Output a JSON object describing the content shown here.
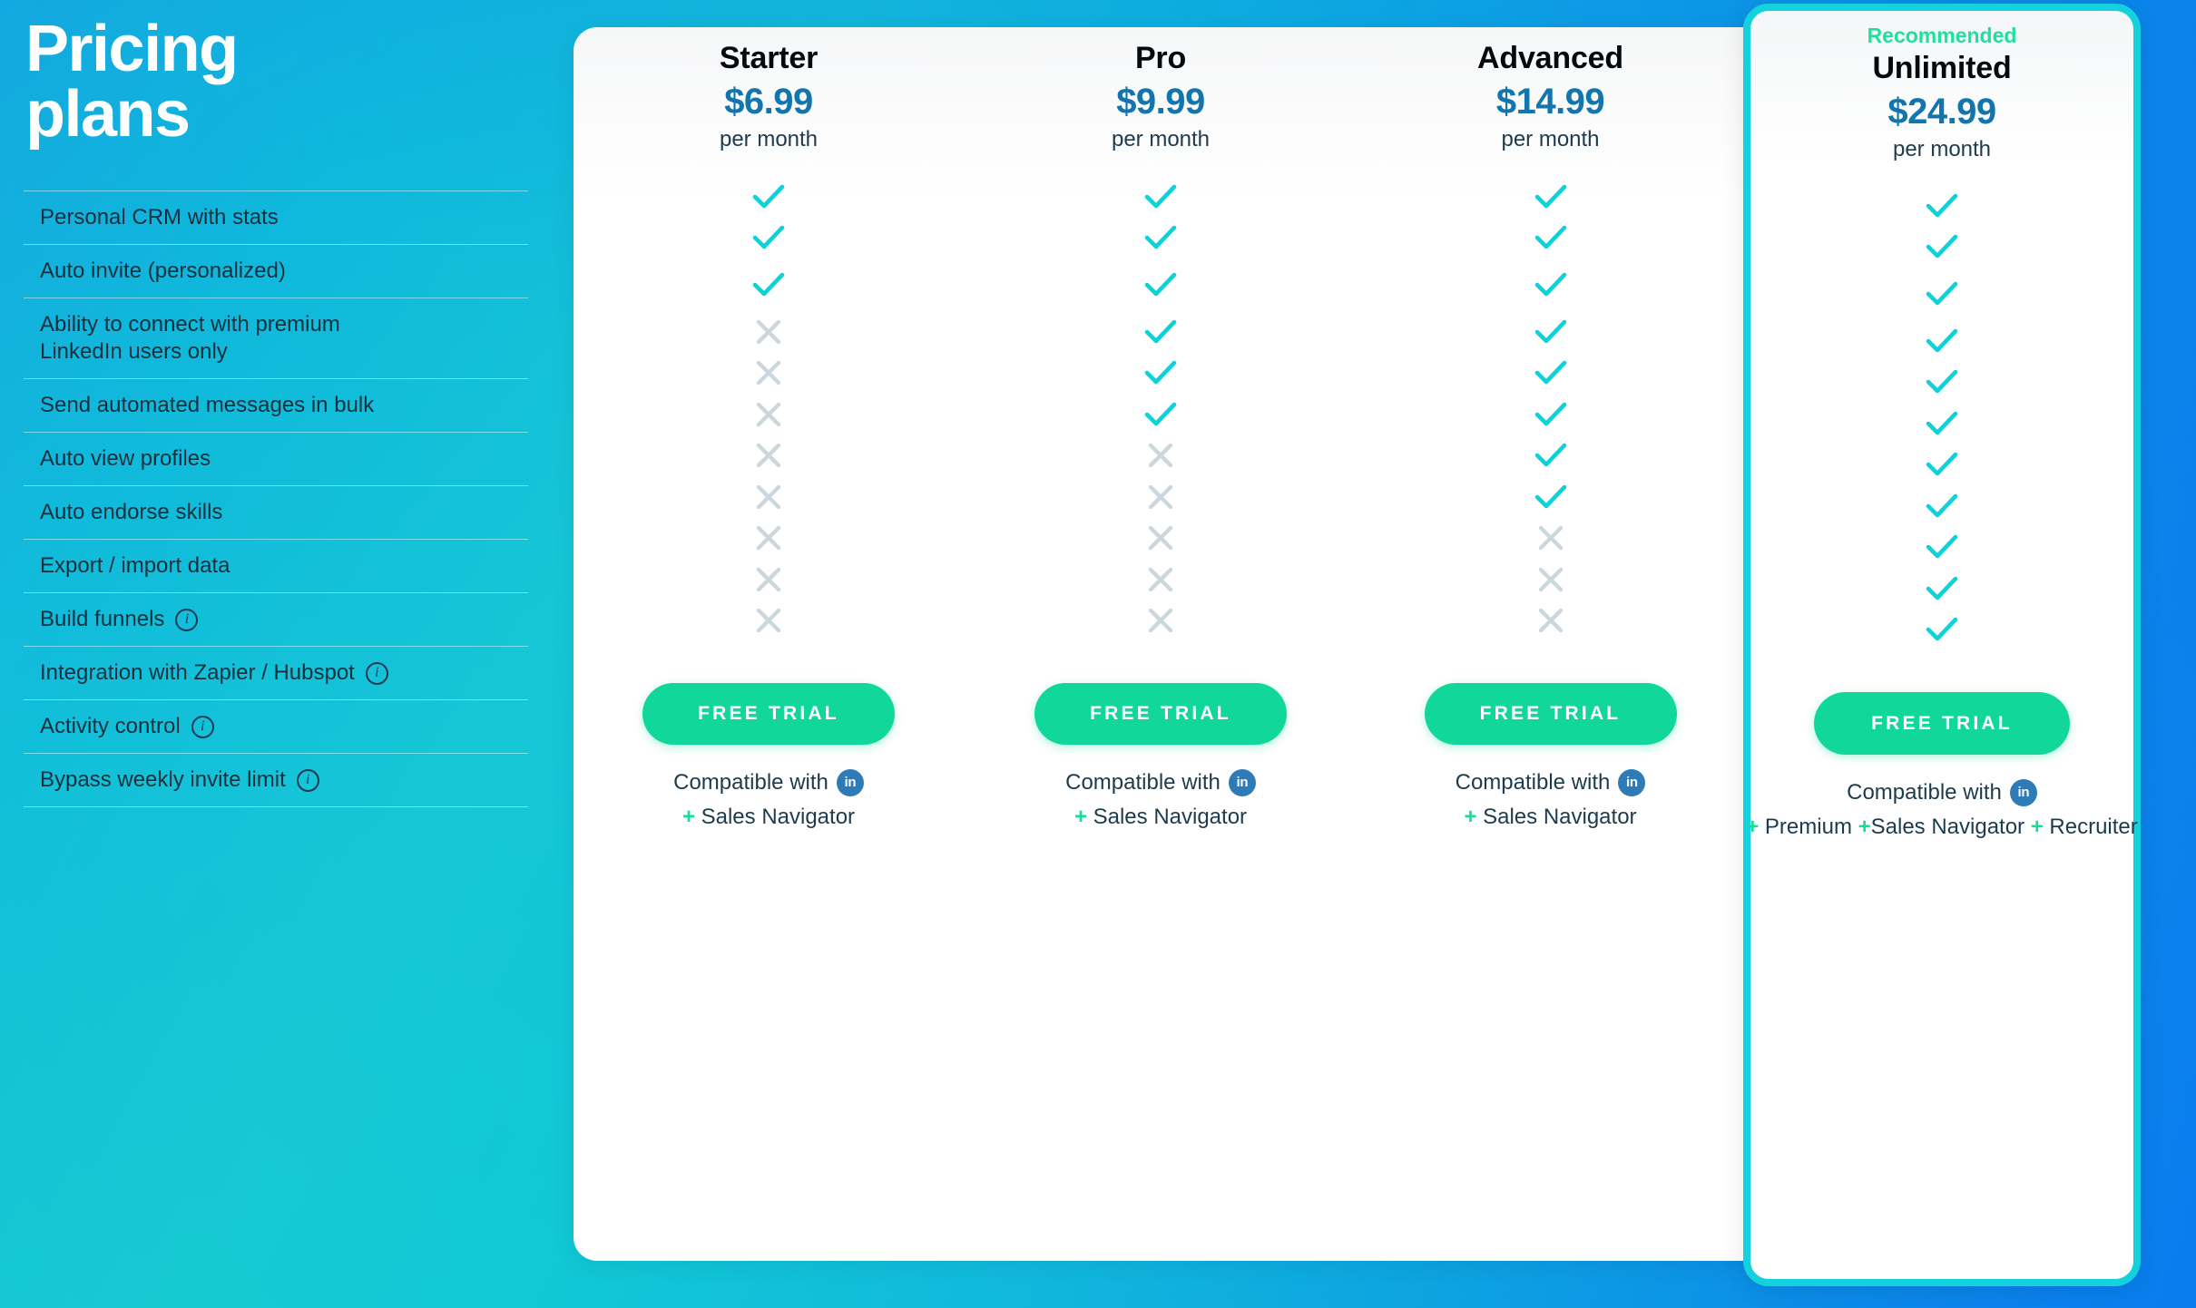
{
  "header": {
    "title_line1": "Pricing",
    "title_line2": "plans"
  },
  "colors": {
    "bg_teal": "#16c7d6",
    "bg_blue": "#0a7bef",
    "price": "#1375ad",
    "check": "#0fd2d9",
    "cross": "#ccd7dd",
    "cta": "#12d79b",
    "recommended": "#1fe0a0",
    "linkedin": "#2d7cb8",
    "plus": "#17dc9c",
    "highlight_border": "#13d2dd"
  },
  "features": [
    {
      "label": "Personal CRM with stats",
      "info": false
    },
    {
      "label": "Auto invite (personalized)",
      "info": false
    },
    {
      "label": "Ability to connect with premium\nLinkedIn users only",
      "info": false
    },
    {
      "label": "Send automated messages in bulk",
      "info": false
    },
    {
      "label": "Auto view profiles",
      "info": false
    },
    {
      "label": "Auto endorse skills",
      "info": false
    },
    {
      "label": "Export / import data",
      "info": false
    },
    {
      "label": "Build funnels",
      "info": true
    },
    {
      "label": "Integration with Zapier / Hubspot",
      "info": true
    },
    {
      "label": "Activity control",
      "info": true
    },
    {
      "label": "Bypass weekly invite limit",
      "info": true
    }
  ],
  "info_icon_glyph": "i",
  "plans": [
    {
      "name": "Starter",
      "price": "$6.99",
      "period": "per month",
      "recommended_label": "",
      "is_recommended": false,
      "marks": [
        true,
        true,
        true,
        false,
        false,
        false,
        false,
        false,
        false,
        false,
        false
      ],
      "cta_label": "FREE TRIAL",
      "compat_text": "Compatible with",
      "compat_badge": "in",
      "compat_addons": "+ Sales Navigator"
    },
    {
      "name": "Pro",
      "price": "$9.99",
      "period": "per month",
      "recommended_label": "",
      "is_recommended": false,
      "marks": [
        true,
        true,
        true,
        true,
        true,
        true,
        false,
        false,
        false,
        false,
        false
      ],
      "cta_label": "FREE TRIAL",
      "compat_text": "Compatible with",
      "compat_badge": "in",
      "compat_addons": "+ Sales Navigator"
    },
    {
      "name": "Advanced",
      "price": "$14.99",
      "period": "per month",
      "recommended_label": "",
      "is_recommended": false,
      "marks": [
        true,
        true,
        true,
        true,
        true,
        true,
        true,
        true,
        false,
        false,
        false
      ],
      "cta_label": "FREE TRIAL",
      "compat_text": "Compatible with",
      "compat_badge": "in",
      "compat_addons": "+ Sales Navigator"
    },
    {
      "name": "Unlimited",
      "price": "$24.99",
      "period": "per month",
      "recommended_label": "Recommended",
      "is_recommended": true,
      "marks": [
        true,
        true,
        true,
        true,
        true,
        true,
        true,
        true,
        true,
        true,
        true
      ],
      "cta_label": "FREE TRIAL",
      "compat_text": "Compatible with",
      "compat_badge": "in",
      "compat_addons": "+ Premium +Sales Navigator + Recruiter"
    }
  ]
}
